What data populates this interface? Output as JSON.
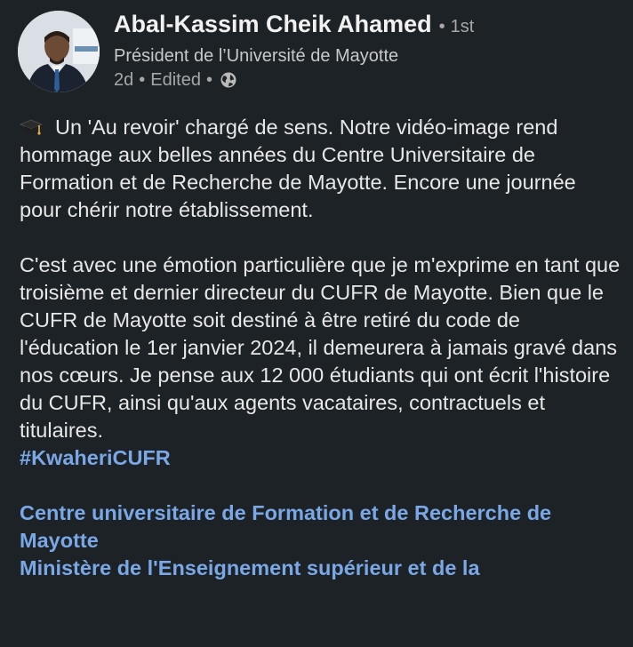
{
  "author": {
    "name": "Abal-Kassim Cheik Ahamed",
    "degree": "1st",
    "headline": "Président de l’Université de Mayotte",
    "time": "2d",
    "edited": "Edited"
  },
  "post": {
    "p1_text": "Un 'Au revoir' chargé de sens. Notre vidéo-image rend hommage aux belles années du Centre Universitaire de Formation et de Recherche de Mayotte. Encore une journée pour chérir notre établissement.",
    "p2_text": "C'est avec une émotion particulière que je m'exprime en tant que troisième et dernier directeur du CUFR de Mayotte. Bien que le CUFR de Mayotte soit destiné à être retiré du code de l'éducation le 1er janvier 2024, il demeurera à jamais gravé dans nos cœurs. Je pense aux 12 000 étudiants qui ont écrit l'histoire du CUFR, ainsi qu'aux agents vacataires, contractuels et titulaires.",
    "hashtag": "#KwaheriCUFR",
    "mention1": "Centre universitaire de Formation et de Recherche de Mayotte",
    "mention2": "Ministère de l'Enseignement supérieur et de la"
  },
  "icons": {
    "emoji": "graduation-cap-icon",
    "visibility": "globe-icon"
  },
  "colors": {
    "background": "#1d2226",
    "link": "#79a8e8",
    "text": "#e7e7e7",
    "muted": "#a7a7a7"
  }
}
